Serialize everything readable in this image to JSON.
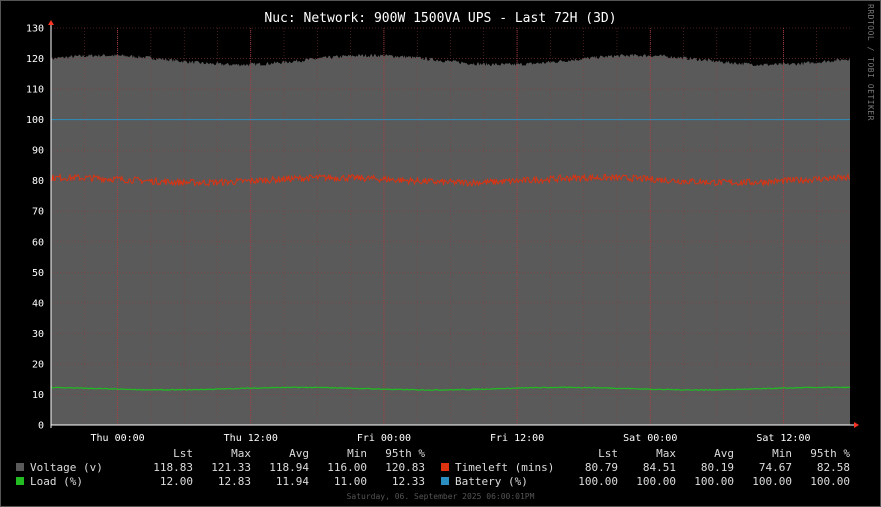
{
  "window": {
    "title": "Nuc: Network: 900W 1500VA UPS - Last 72H (3D)",
    "watermark": "RRDTOOL / TOBI OETIKER",
    "footer": "Saturday, 06. September 2025 06:00:01PM"
  },
  "colors": {
    "background": "#000000",
    "plot_area": "#5a5a5a",
    "grid": "#8a3a3a",
    "voltage": "#5a5a5a",
    "load": "#22bb22",
    "timeleft": "#dd3311",
    "battery": "#2a8fc0"
  },
  "chart_data": {
    "type": "area",
    "title": "Nuc: Network: 900W 1500VA UPS - Last 72H (3D)",
    "xlabel": "",
    "ylabel": "",
    "ylim": [
      0,
      130
    ],
    "yticks": [
      0,
      10,
      20,
      30,
      40,
      50,
      60,
      70,
      80,
      90,
      100,
      110,
      120,
      130
    ],
    "xlim_hours": [
      -72,
      0
    ],
    "xticks": [
      {
        "label": "Thu 00:00",
        "hours": -66
      },
      {
        "label": "Thu 12:00",
        "hours": -54
      },
      {
        "label": "Fri 00:00",
        "hours": -42
      },
      {
        "label": "Fri 12:00",
        "hours": -30
      },
      {
        "label": "Sat 00:00",
        "hours": -18
      },
      {
        "label": "Sat 12:00",
        "hours": -6
      }
    ],
    "grid": true,
    "series": [
      {
        "name": "Voltage (v)",
        "approx": {
          "base": 119.5,
          "amplitude": 1.5,
          "noise": 1.2
        }
      },
      {
        "name": "Timeleft (mins)",
        "approx": {
          "base": 80.2,
          "amplitude": 0.8,
          "noise": 2.2
        }
      },
      {
        "name": "Battery (%)",
        "approx": {
          "base": 100,
          "amplitude": 0,
          "noise": 0
        }
      },
      {
        "name": "Load (%)",
        "approx": {
          "base": 11.9,
          "amplitude": 0.4,
          "noise": 0.3
        }
      }
    ]
  },
  "legend": {
    "headers": [
      "Lst",
      "Max",
      "Avg",
      "Min",
      "95th %"
    ],
    "rows": [
      {
        "left": {
          "name": "Voltage (v)",
          "values": [
            "118.83",
            "121.33",
            "118.94",
            "116.00",
            "120.83"
          ]
        },
        "right": {
          "name": "Timeleft (mins)",
          "values": [
            "80.79",
            "84.51",
            "80.19",
            "74.67",
            "82.58"
          ]
        }
      },
      {
        "left": {
          "name": "Load (%)",
          "values": [
            "12.00",
            "12.83",
            "11.94",
            "11.00",
            "12.33"
          ]
        },
        "right": {
          "name": "Battery (%)",
          "values": [
            "100.00",
            "100.00",
            "100.00",
            "100.00",
            "100.00"
          ]
        }
      }
    ]
  }
}
